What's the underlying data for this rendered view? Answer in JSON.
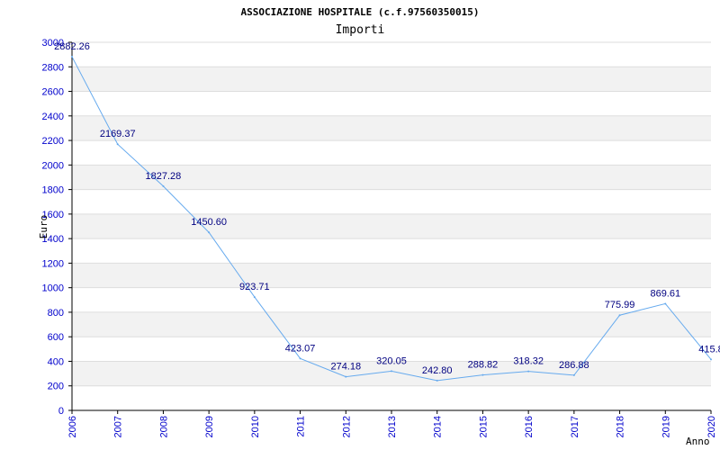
{
  "chart_data": {
    "type": "line",
    "title": "ASSOCIAZIONE HOSPITALE (c.f.97560350015)",
    "subtitle": "Importi",
    "xlabel": "Anno",
    "ylabel": "Euro",
    "x": [
      "2006",
      "2007",
      "2008",
      "2009",
      "2010",
      "2011",
      "2012",
      "2013",
      "2014",
      "2015",
      "2016",
      "2017",
      "2018",
      "2019",
      "2020"
    ],
    "series": [
      {
        "values": [
          2882.26,
          2169.37,
          1827.28,
          1450.6,
          923.71,
          423.07,
          274.18,
          320.05,
          242.8,
          288.82,
          318.32,
          286.88,
          775.99,
          869.61,
          415.8
        ],
        "labels": [
          "2882.26",
          "2169.37",
          "1827.28",
          "1450.60",
          "923.71",
          "423.07",
          "274.18",
          "320.05",
          "242.80",
          "288.82",
          "318.32",
          "286.88",
          "775.99",
          "869.61",
          "415.8"
        ]
      }
    ],
    "ylim": [
      0,
      3000
    ],
    "yticks": [
      0,
      200,
      400,
      600,
      800,
      1000,
      1200,
      1400,
      1600,
      1800,
      2000,
      2200,
      2400,
      2600,
      2800,
      3000
    ],
    "grid": true,
    "legend": "none",
    "colors": {
      "line": "#66aaee",
      "band": "#f2f2f2",
      "gridline": "#dddddd",
      "axis": "#000000",
      "tick_text": "#0000cc",
      "data_label": "#000080"
    }
  }
}
